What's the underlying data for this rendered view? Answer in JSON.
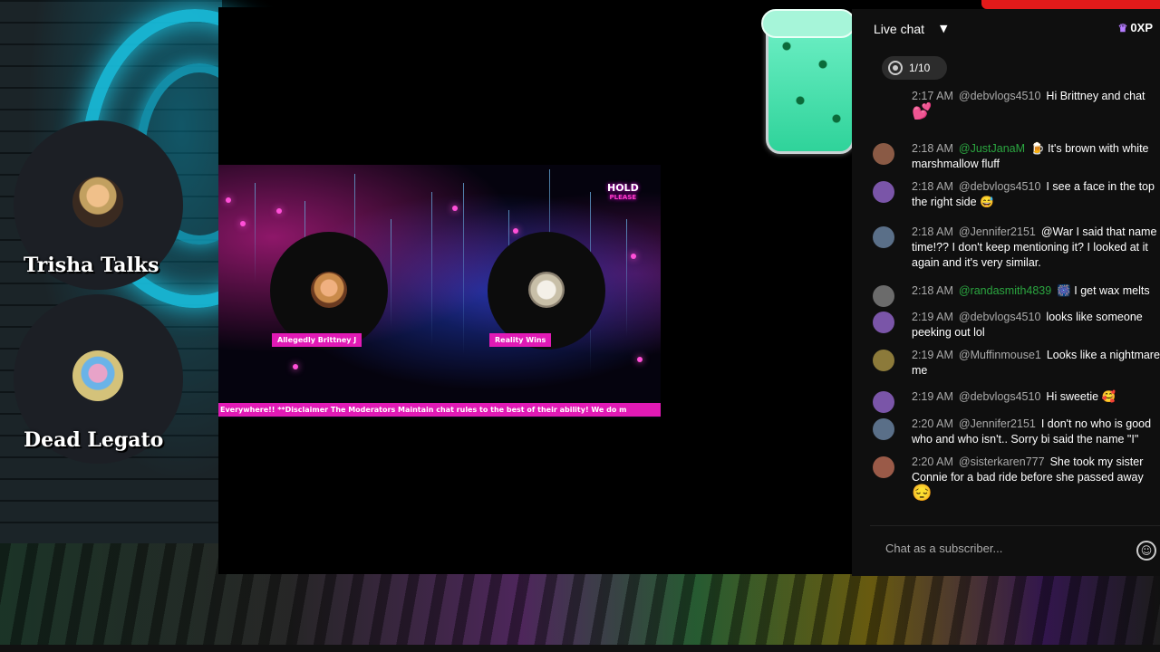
{
  "hosts": [
    {
      "name": "Trisha Talks"
    },
    {
      "name": "Dead Legato"
    }
  ],
  "stream": {
    "hold_badge": {
      "top": "HOLD",
      "bottom": "PLEASE"
    },
    "guests": [
      {
        "label": "Allegedly Brittney J"
      },
      {
        "label": "Reality Wins"
      }
    ],
    "ticker": "Everywhere!! **Disclaimer The Moderators Maintain chat rules to the best of their ability! We do m"
  },
  "chat": {
    "title": "Live chat",
    "xp": "0XP",
    "goal": "1/10",
    "input_placeholder": "Chat as a subscriber...",
    "messages": [
      {
        "time": "2:17 AM",
        "author": "@debvlogs4510",
        "member": false,
        "text": "Hi Brittney and chat",
        "line2": "💕",
        "avatar_color": "#7a55a8"
      },
      {
        "time": "2:18 AM",
        "author": "@JustJanaM",
        "member": true,
        "text": "🍺 It's brown with white",
        "line2": "marshmallow fluff",
        "avatar_color": "#8a5a45"
      },
      {
        "time": "2:18 AM",
        "author": "@debvlogs4510",
        "member": false,
        "text": "I see a face in the top",
        "line2": "the right side 😅",
        "avatar_color": "#7a55a8"
      },
      {
        "time": "2:18 AM",
        "author": "@Jennifer2151",
        "member": false,
        "text": "@War I said that name",
        "line2": "time!?? I don't keep mentioning it? I looked at it",
        "line3": "again and it's very similar.",
        "avatar_color": "#5a6f88"
      },
      {
        "time": "2:18 AM",
        "author": "@randasmith4839",
        "member": true,
        "text": "🎆 I get wax melts",
        "avatar_color": "#6b6b6b"
      },
      {
        "time": "2:19 AM",
        "author": "@debvlogs4510",
        "member": false,
        "text": "looks like someone",
        "line2": "peeking out lol",
        "avatar_color": "#7a55a8"
      },
      {
        "time": "2:19 AM",
        "author": "@Muffinmouse1",
        "member": false,
        "text": "Looks like a nightmare",
        "line2": "me",
        "avatar_color": "#8c7a3a"
      },
      {
        "time": "2:19 AM",
        "author": "@debvlogs4510",
        "member": false,
        "text": "Hi sweetie 🥰",
        "avatar_color": "#7a55a8"
      },
      {
        "time": "2:20 AM",
        "author": "@Jennifer2151",
        "member": false,
        "text": "I don't no who is good",
        "line2": "who and who isn't.. Sorry bi said the name \"I\"",
        "avatar_color": "#5a6f88"
      },
      {
        "time": "2:20 AM",
        "author": "@sisterkaren777",
        "member": false,
        "text": "She took my sister",
        "line2": "Connie for a bad ride before she passed away",
        "line3": "😔",
        "avatar_color": "#9a5a48"
      }
    ]
  },
  "colors": {
    "accent_pink": "#e11ab5",
    "member_green": "#2ba640",
    "live_red": "#e21a1a",
    "neon_cyan": "#19c6e6"
  }
}
